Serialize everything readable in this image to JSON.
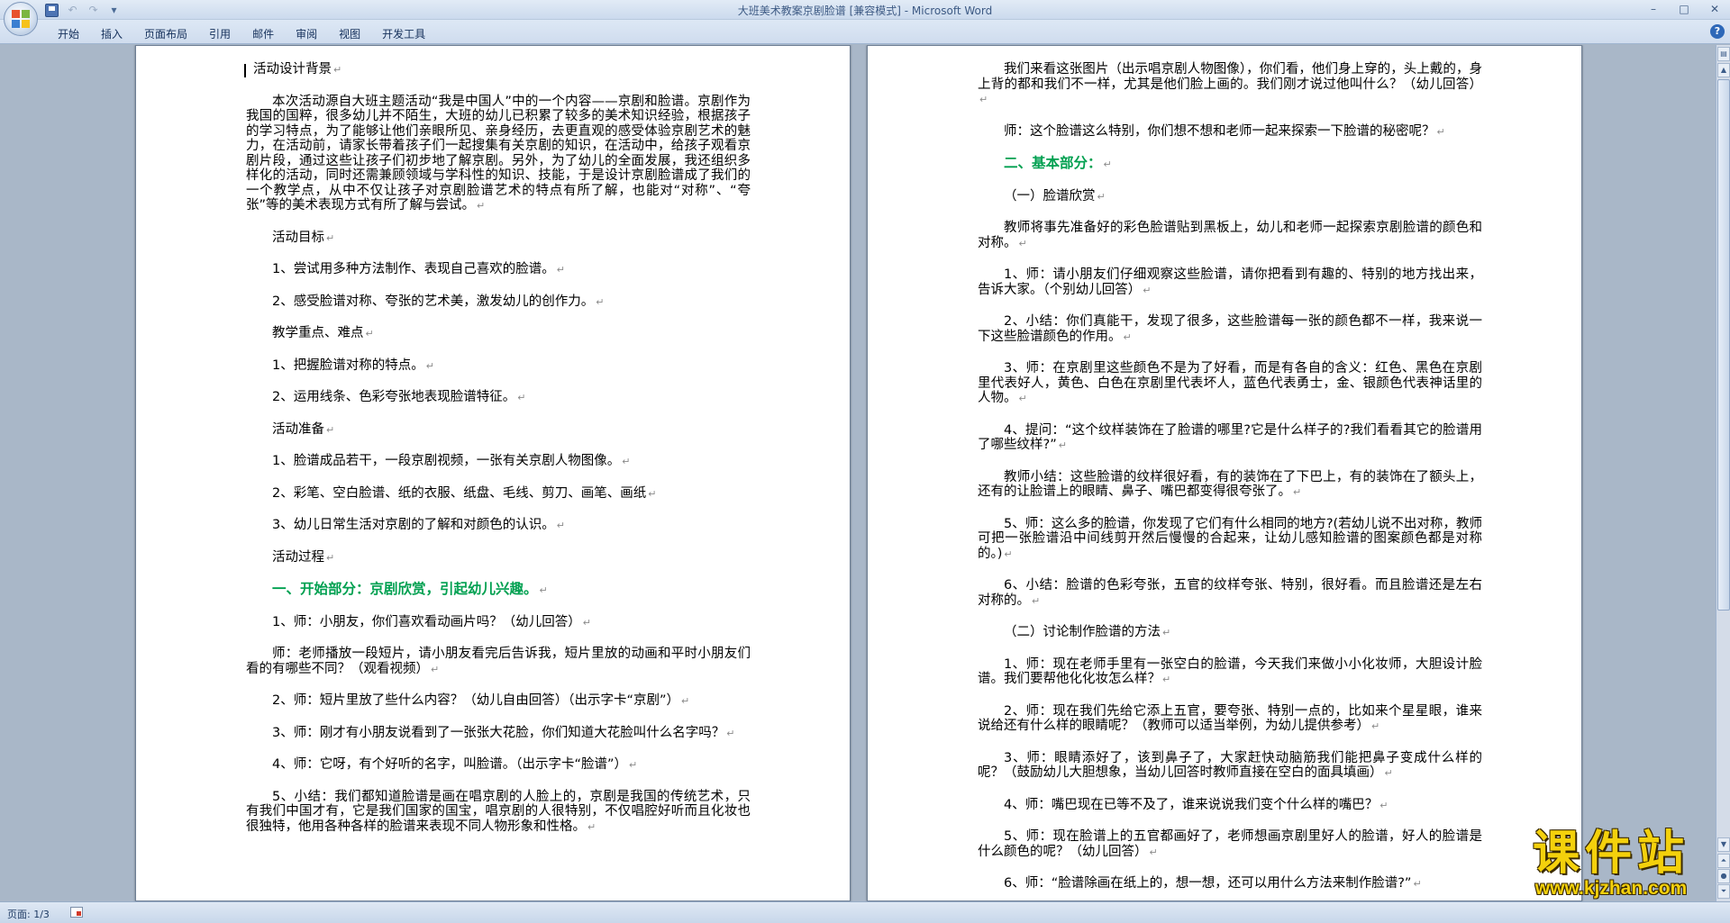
{
  "window": {
    "title": "大班美术教案京剧脸谱 [兼容模式] - Microsoft Word",
    "controls": [
      "–",
      "□",
      "✕"
    ]
  },
  "quick_access": {
    "save": "save-icon",
    "undo": "↶",
    "redo": "↷",
    "customize": "▾"
  },
  "ribbon": {
    "tabs": [
      "开始",
      "插入",
      "页面布局",
      "引用",
      "邮件",
      "审阅",
      "视图",
      "开发工具"
    ],
    "help": "?"
  },
  "page1": {
    "paragraphs": [
      "活动设计背景",
      "本次活动源自大班主题活动“我是中国人”中的一个内容——京剧和脸谱。京剧作为我国的国粹，很多幼儿并不陌生，大班的幼儿已积累了较多的美术知识经验，根据孩子的学习特点，为了能够让他们亲眼所见、亲身经历，去更直观的感受体验京剧艺术的魅力，在活动前，请家长带着孩子们一起搜集有关京剧的知识，在活动中，给孩子观看京剧片段，通过这些让孩子们初步地了解京剧。另外，为了幼儿的全面发展，我还组织多样化的活动，同时还需兼顾领域与学科性的知识、技能，于是设计京剧脸谱成了我们的一个教学点，从中不仅让孩子对京剧脸谱艺术的特点有所了解，也能对“对称”、“夸张”等的美术表现方式有所了解与尝试。",
      "活动目标",
      "1、尝试用多种方法制作、表现自己喜欢的脸谱。",
      "2、感受脸谱对称、夸张的艺术美，激发幼儿的创作力。",
      "教学重点、难点",
      "1、把握脸谱对称的特点。",
      "2、运用线条、色彩夸张地表现脸谱特征。",
      "活动准备",
      "1、脸谱成品若干，一段京剧视频，一张有关京剧人物图像。",
      "2、彩笔、空白脸谱、纸的衣服、纸盘、毛线、剪刀、画笔、画纸",
      "3、幼儿日常生活对京剧的了解和对颜色的认识。",
      "活动过程",
      "一、开始部分：京剧欣赏，引起幼儿兴趣。",
      "1、师：小朋友，你们喜欢看动画片吗？（幼儿回答）",
      "师：老师播放一段短片，请小朋友看完后告诉我，短片里放的动画和平时小朋友们看的有哪些不同？（观看视频）",
      "2、师：短片里放了些什么内容？（幼儿自由回答）（出示字卡“京剧”）",
      "3、师：刚才有小朋友说看到了一张张大花脸，你们知道大花脸叫什么名字吗？",
      "4、师：它呀，有个好听的名字，叫脸谱。（出示字卡“脸谱”）",
      "5、小结：我们都知道脸谱是画在唱京剧的人脸上的，京剧是我国的传统艺术，只有我们中国才有，它是我们国家的国宝，唱京剧的人很特别，不仅唱腔好听而且化妆也很独特，他用各种各样的脸谱来表现不同人物形象和性格。"
    ]
  },
  "page2": {
    "paragraphs": [
      "我们来看这张图片（出示唱京剧人物图像），你们看，他们身上穿的，头上戴的，身上背的都和我们不一样，尤其是他们脸上画的。我们刚才说过他叫什么？（幼儿回答）",
      "师：这个脸谱这么特别，你们想不想和老师一起来探索一下脸谱的秘密呢？",
      "二、基本部分：",
      "（一）脸谱欣赏",
      "教师将事先准备好的彩色脸谱贴到黑板上，幼儿和老师一起探索京剧脸谱的颜色和对称。",
      "1、师：请小朋友们仔细观察这些脸谱，请你把看到有趣的、特别的地方找出来，告诉大家。（个别幼儿回答）",
      "2、小结：你们真能干，发现了很多，这些脸谱每一张的颜色都不一样，我来说一下这些脸谱颜色的作用。",
      "3、师：在京剧里这些颜色不是为了好看，而是有各自的含义：红色、黑色在京剧里代表好人，黄色、白色在京剧里代表坏人，蓝色代表勇士，金、银颜色代表神话里的人物。",
      "4、提问：“这个纹样装饰在了脸谱的哪里?它是什么样子的?我们看看其它的脸谱用了哪些纹样?”",
      "教师小结：这些脸谱的纹样很好看，有的装饰在了下巴上，有的装饰在了额头上，还有的让脸谱上的眼睛、鼻子、嘴巴都变得很夸张了。",
      "5、师：这么多的脸谱，你发现了它们有什么相同的地方?(若幼儿说不出对称，教师可把一张脸谱沿中间线剪开然后慢慢的合起来，让幼儿感知脸谱的图案颜色都是对称的。)",
      "6、小结：脸谱的色彩夸张，五官的纹样夸张、特别，很好看。而且脸谱还是左右对称的。",
      "（二）讨论制作脸谱的方法",
      "1、师：现在老师手里有一张空白的脸谱，今天我们来做小小化妆师，大胆设计脸谱。我们要帮他化化妆怎么样？",
      "2、师：现在我们先给它添上五官，要夸张、特别一点的，比如来个星星眼，谁来说给还有什么样的眼睛呢？（教师可以适当举例，为幼儿提供参考）",
      "3、师：眼睛添好了，该到鼻子了，大家赶快动脑筋我们能把鼻子变成什么样的呢？（鼓励幼儿大胆想象，当幼儿回答时教师直接在空白的面具填画）",
      "4、师：嘴巴现在已等不及了，谁来说说我们变个什么样的嘴巴？",
      "5、师：现在脸谱上的五官都画好了，老师想画京剧里好人的脸谱，好人的脸谱是什么颜色的呢？（幼儿回答）",
      "6、师：“脸谱除画在纸上的，想一想，还可以用什么方法来制作脸谱?”"
    ]
  },
  "statusbar": {
    "page": "页面: 1/3"
  },
  "watermark": {
    "text": "课件站",
    "url": "www.kjzhan.com"
  },
  "colors": {
    "heading": "#00a050",
    "titlebar": "#cbdaed",
    "docbg": "#a9b7c8"
  }
}
